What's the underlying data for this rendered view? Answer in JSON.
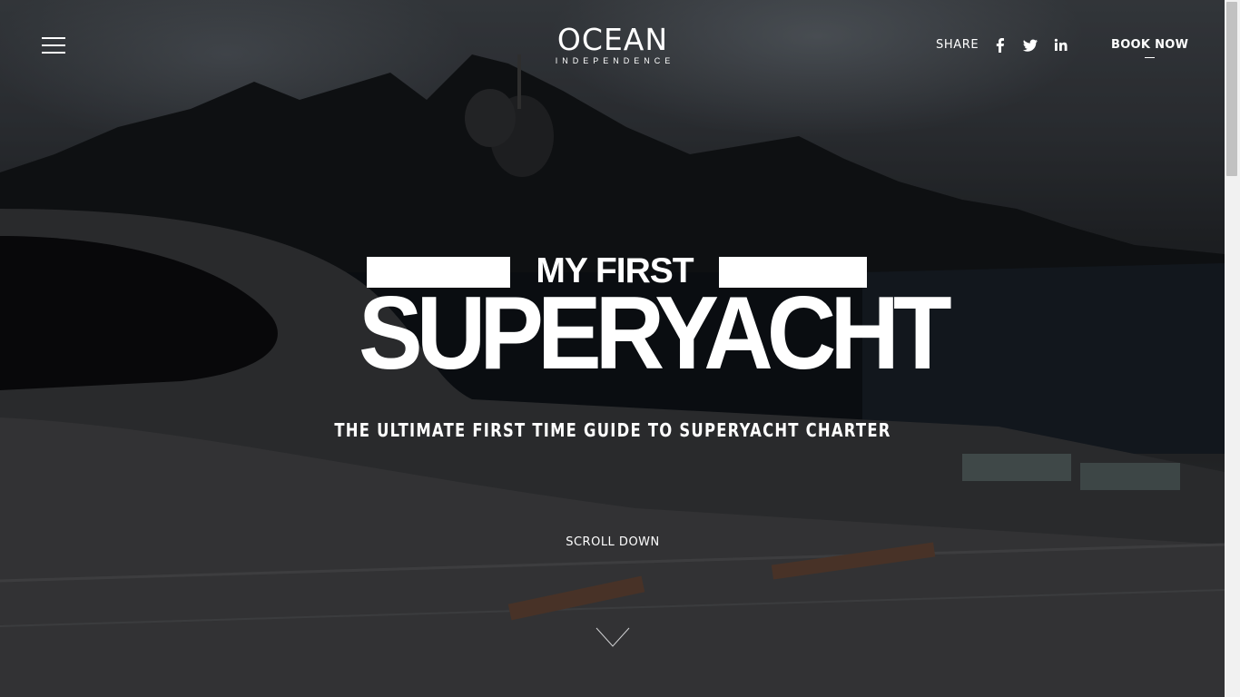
{
  "header": {
    "logo_main": "OCEAN",
    "logo_sub": "INDEPENDENCE",
    "share_label": "SHARE",
    "social_icons": [
      "facebook-icon",
      "twitter-icon",
      "linkedin-icon"
    ],
    "book_now": "BOOK NOW"
  },
  "hero": {
    "title_line1": "MY FIRST",
    "title_line2": "SUPERYACHT",
    "subtitle": "THE ULTIMATE FIRST TIME GUIDE TO SUPERYACHT CHARTER",
    "scroll_label": "SCROLL DOWN"
  },
  "colors": {
    "text": "#ffffff",
    "overlay": "#000000"
  }
}
